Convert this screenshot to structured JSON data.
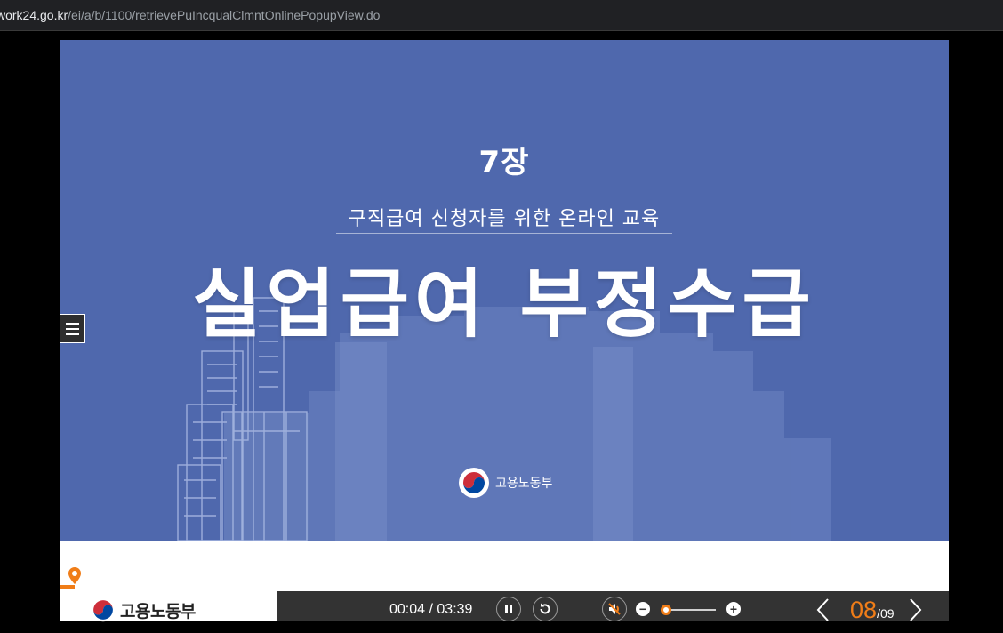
{
  "browser": {
    "url_domain": "work24.go.kr",
    "url_path": "/ei/a/b/1100/retrievePuIncqualClmntOnlinePopupView.do"
  },
  "slide": {
    "chapter": "7장",
    "subtitle": "구직급여 신청자를 위한 온라인 교육",
    "title": "실업급여 부정수급",
    "logo_label": "고용노동부"
  },
  "footer": {
    "logo_label": "고용노동부"
  },
  "player": {
    "current_time": "00:04",
    "separator": " / ",
    "total_time": "03:39",
    "volume_level": 0.1,
    "current_page": "08",
    "page_separator": "/",
    "total_pages": "09"
  },
  "icons": [
    "menu-icon",
    "location-pin-icon",
    "pause-icon",
    "replay-icon",
    "mute-icon",
    "minus-icon",
    "plus-icon",
    "chevron-left-icon",
    "chevron-right-icon",
    "taegeuk-icon"
  ],
  "colors": {
    "slide_bg": "#4f68ad",
    "accent": "#f07d18",
    "controls_bg": "#333333"
  }
}
